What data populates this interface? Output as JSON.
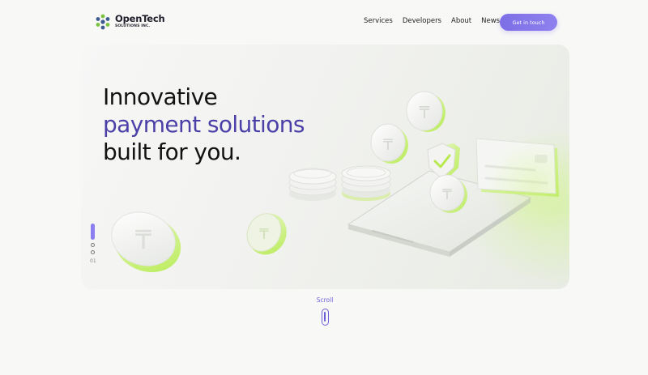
{
  "brand": {
    "name": "OpenTech",
    "sub": "SOLUTIONS INC.",
    "icon": "hexagon-dots-logo-icon",
    "colors": {
      "dark": "#3f5a8f",
      "green": "#7cc242",
      "purple": "#8a7ef0"
    }
  },
  "nav": {
    "items": [
      {
        "label": "Services"
      },
      {
        "label": "Developers"
      },
      {
        "label": "About"
      },
      {
        "label": "News"
      }
    ],
    "cta_label": "Get in touch"
  },
  "hero": {
    "headline_line1": "Innovative",
    "headline_line2": "payment solutions",
    "headline_line3": "built for you.",
    "accent_color": "#4b3fa8",
    "slide_number": "01",
    "illustration": "3d-coins-phone-card-shield-illustration"
  },
  "scroll": {
    "label": "Scroll",
    "icon": "mouse-scroll-icon",
    "color": "#6a5ed8"
  }
}
